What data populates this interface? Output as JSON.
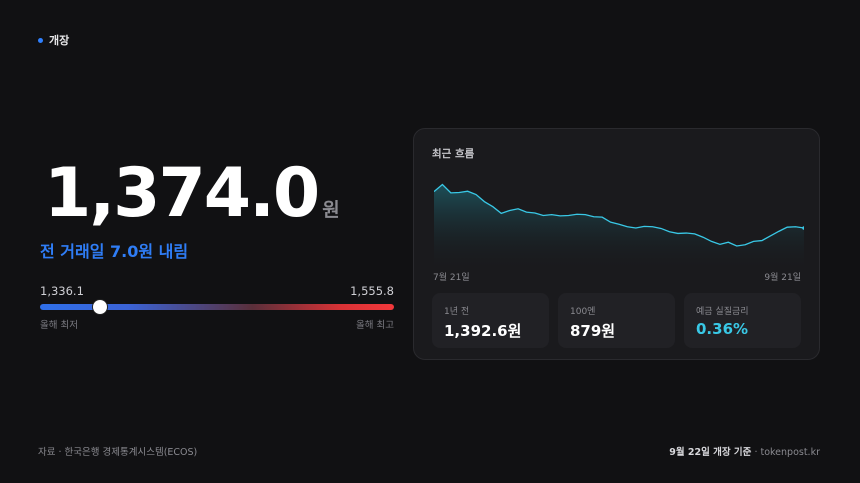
{
  "status": {
    "label": "개장",
    "dot_color": "#2f80ff"
  },
  "rate": {
    "value": "1,374.0",
    "unit": "원"
  },
  "change": {
    "text": "전 거래일 7.0원 내림",
    "color": "#2f7df6"
  },
  "range": {
    "min_value": "1,336.1",
    "max_value": "1,555.8",
    "min_label": "올해 최저",
    "max_label": "올해 최고",
    "position_fraction": 0.17
  },
  "card": {
    "title": "최근 흐름",
    "x_start": "7월 21일",
    "x_end": "9월 21일",
    "stats": [
      {
        "label": "1년 전",
        "value": "1,392.6원"
      },
      {
        "label": "100엔",
        "value": "879원"
      },
      {
        "label": "예금 실질금리",
        "value": "0.36%"
      }
    ]
  },
  "chart_data": {
    "type": "area",
    "title": "최근 흐름",
    "xlabel": "",
    "ylabel": "",
    "x_start": "7월 21일",
    "x_end": "9월 21일",
    "values": [
      1388.5,
      1390.2,
      1388.2,
      1388.3,
      1388.6,
      1387.8,
      1386.1,
      1384.9,
      1383.3,
      1384.0,
      1384.4,
      1383.6,
      1383.4,
      1382.8,
      1383.0,
      1382.7,
      1382.8,
      1383.1,
      1383.0,
      1382.5,
      1382.4,
      1381.2,
      1380.7,
      1380.1,
      1379.8,
      1380.2,
      1380.1,
      1379.7,
      1378.9,
      1378.5,
      1378.6,
      1378.4,
      1377.6,
      1376.6,
      1375.9,
      1376.4,
      1375.5,
      1375.8,
      1376.6,
      1376.8,
      1377.9,
      1379.0,
      1380.0,
      1380.1,
      1379.8
    ],
    "ylim": [
      1370,
      1392
    ],
    "line_color": "#39c8e6",
    "grid": false
  },
  "footer": {
    "source": "자료 · 한국은행 경제통계시스템(ECOS)",
    "date": "9월 22일 개장 기준",
    "site": "· tokenpost.kr"
  }
}
